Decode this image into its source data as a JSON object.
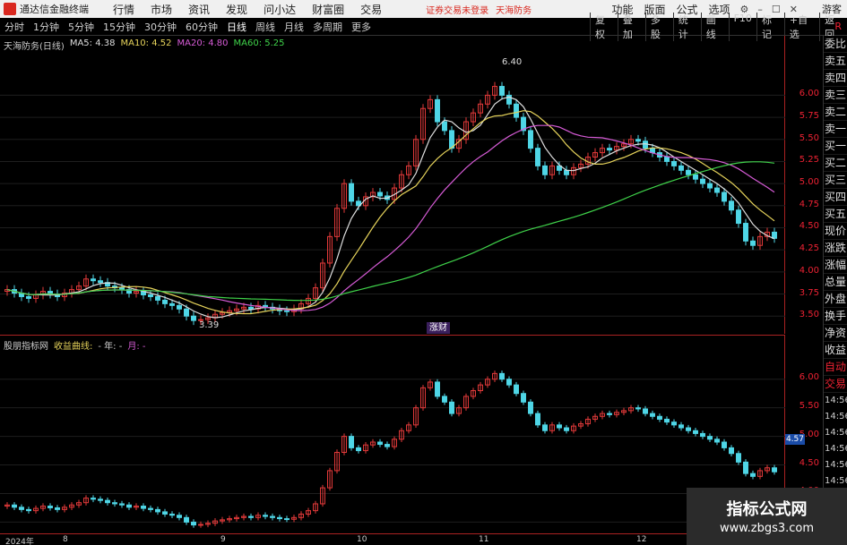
{
  "menubar": {
    "app_title": "通达信金融终端",
    "menus": [
      "行情",
      "市场",
      "资讯",
      "发现",
      "问小达",
      "财富圈",
      "交易"
    ],
    "notice": "证券交易未登录",
    "stock_name": "天海防务",
    "right_menus": [
      "功能",
      "版面",
      "公式",
      "选项"
    ],
    "guest": "游客"
  },
  "periodbar": {
    "periods": [
      "分时",
      "1分钟",
      "5分钟",
      "15分钟",
      "30分钟",
      "60分钟",
      "日线",
      "周线",
      "月线",
      "多周期",
      "更多"
    ],
    "active": "日线",
    "tools": [
      "复权",
      "叠加",
      "多股",
      "统计",
      "画线",
      "F10",
      "标记",
      "+自选",
      "返回"
    ],
    "corner": "R"
  },
  "upper_legend": {
    "title": "天海防务(日线)",
    "ma5": "MA5: 4.38",
    "ma10": "MA10: 4.52",
    "ma20": "MA20: 4.80",
    "ma60": "MA60: 5.25"
  },
  "lower_legend": {
    "title": "股朋指标网",
    "indicator": "收益曲线:",
    "year": "- 年: -",
    "month": "月: -"
  },
  "annotations": {
    "high": "6.40",
    "low": "3.39",
    "tag": "涨财"
  },
  "upper_axis_labels": [
    "6.00",
    "5.75",
    "5.50",
    "5.25",
    "5.00",
    "4.75",
    "4.50",
    "4.25",
    "4.00",
    "3.75",
    "3.50"
  ],
  "lower_axis_labels": [
    "6.00",
    "5.50",
    "5.00",
    "4.50",
    "4.00"
  ],
  "price_tag": "4.57",
  "date_labels": [
    "2024年",
    "8",
    "9",
    "10",
    "11",
    "12"
  ],
  "side_panel": {
    "items": [
      "委比",
      "卖五",
      "卖四",
      "卖三",
      "卖二",
      "卖一",
      "买一",
      "买二",
      "买三",
      "买四",
      "买五",
      "现价",
      "涨跌",
      "涨幅",
      "总量",
      "外盘",
      "换手",
      "净资",
      "收益"
    ],
    "tabs": [
      "自动",
      "交易"
    ],
    "times": [
      "14:56",
      "14:56",
      "14:56",
      "14:56",
      "14:56",
      "14:56",
      "14:56",
      "14:56",
      "14:56"
    ]
  },
  "watermark": {
    "line1": "指标公式网",
    "line2": "www.zbgs3.com"
  },
  "colors": {
    "up": "#e23a3a",
    "down": "#4fd6e6",
    "ma5": "#dddddd",
    "ma10": "#e6d35b",
    "ma20": "#d65bd6",
    "ma60": "#3fd24a"
  },
  "chart_data": {
    "type": "candlestick",
    "x": [
      "7-22",
      "7-23",
      "7-24",
      "7-25",
      "7-26",
      "7-29",
      "7-30",
      "7-31",
      "8-1",
      "8-2",
      "8-5",
      "8-6",
      "8-7",
      "8-8",
      "8-9",
      "8-12",
      "8-13",
      "8-14",
      "8-15",
      "8-16",
      "8-19",
      "8-20",
      "8-21",
      "8-22",
      "8-23",
      "8-26",
      "8-27",
      "8-28",
      "8-29",
      "8-30",
      "9-2",
      "9-3",
      "9-4",
      "9-5",
      "9-6",
      "9-9",
      "9-10",
      "9-11",
      "9-12",
      "9-13",
      "9-18",
      "9-19",
      "9-20",
      "9-23",
      "9-24",
      "9-25",
      "9-26",
      "9-27",
      "9-30",
      "10-8",
      "10-9",
      "10-10",
      "10-11",
      "10-14",
      "10-15",
      "10-16",
      "10-17",
      "10-18",
      "10-21",
      "10-22",
      "10-23",
      "10-24",
      "10-25",
      "10-28",
      "10-29",
      "10-30",
      "10-31",
      "11-1",
      "11-4",
      "11-5",
      "11-6",
      "11-7",
      "11-8",
      "11-11",
      "11-12",
      "11-13",
      "11-14",
      "11-15",
      "11-18",
      "11-19",
      "11-20",
      "11-21",
      "11-22",
      "11-25",
      "11-26",
      "11-27",
      "11-28",
      "11-29",
      "12-2",
      "12-3",
      "12-4",
      "12-5",
      "12-6",
      "12-9",
      "12-10",
      "12-11",
      "12-12",
      "12-13",
      "12-16",
      "12-17",
      "12-18",
      "12-19",
      "12-20",
      "12-23",
      "12-24",
      "12-25",
      "12-26",
      "12-27"
    ],
    "open": [
      3.78,
      3.8,
      3.76,
      3.72,
      3.7,
      3.74,
      3.78,
      3.75,
      3.72,
      3.76,
      3.8,
      3.84,
      3.92,
      3.9,
      3.88,
      3.84,
      3.82,
      3.8,
      3.76,
      3.78,
      3.74,
      3.72,
      3.68,
      3.64,
      3.62,
      3.58,
      3.5,
      3.45,
      3.46,
      3.48,
      3.52,
      3.54,
      3.56,
      3.58,
      3.6,
      3.58,
      3.62,
      3.6,
      3.58,
      3.56,
      3.55,
      3.58,
      3.64,
      3.7,
      3.82,
      4.1,
      4.4,
      4.72,
      5.0,
      4.8,
      4.75,
      4.85,
      4.9,
      4.86,
      4.82,
      4.95,
      5.1,
      5.2,
      5.5,
      5.85,
      5.95,
      5.7,
      5.6,
      5.4,
      5.5,
      5.7,
      5.8,
      5.9,
      6.0,
      6.1,
      6.0,
      5.9,
      5.75,
      5.6,
      5.4,
      5.2,
      5.1,
      5.2,
      5.15,
      5.1,
      5.18,
      5.22,
      5.3,
      5.35,
      5.4,
      5.38,
      5.42,
      5.45,
      5.5,
      5.48,
      5.4,
      5.35,
      5.3,
      5.25,
      5.2,
      5.15,
      5.1,
      5.05,
      5.0,
      4.95,
      4.9,
      4.8,
      4.7,
      4.55,
      4.35,
      4.3,
      4.4,
      4.45
    ],
    "close": [
      3.8,
      3.76,
      3.72,
      3.7,
      3.74,
      3.78,
      3.75,
      3.72,
      3.76,
      3.8,
      3.84,
      3.92,
      3.9,
      3.88,
      3.84,
      3.82,
      3.8,
      3.76,
      3.78,
      3.74,
      3.72,
      3.68,
      3.64,
      3.62,
      3.58,
      3.5,
      3.45,
      3.46,
      3.48,
      3.52,
      3.54,
      3.56,
      3.58,
      3.6,
      3.58,
      3.62,
      3.6,
      3.58,
      3.56,
      3.55,
      3.58,
      3.64,
      3.7,
      3.82,
      4.1,
      4.4,
      4.72,
      5.0,
      4.8,
      4.75,
      4.85,
      4.9,
      4.86,
      4.82,
      4.95,
      5.1,
      5.2,
      5.5,
      5.85,
      5.95,
      5.7,
      5.6,
      5.4,
      5.5,
      5.7,
      5.8,
      5.9,
      6.0,
      6.1,
      6.0,
      5.9,
      5.75,
      5.6,
      5.4,
      5.2,
      5.1,
      5.2,
      5.15,
      5.1,
      5.18,
      5.22,
      5.3,
      5.35,
      5.4,
      5.38,
      5.42,
      5.45,
      5.5,
      5.48,
      5.4,
      5.35,
      5.3,
      5.25,
      5.2,
      5.15,
      5.1,
      5.05,
      5.0,
      4.95,
      4.9,
      4.8,
      4.7,
      4.55,
      4.35,
      4.3,
      4.4,
      4.45,
      4.38
    ],
    "ylim": [
      3.35,
      6.45
    ],
    "high_label": "6.40",
    "low_label": "3.39"
  }
}
